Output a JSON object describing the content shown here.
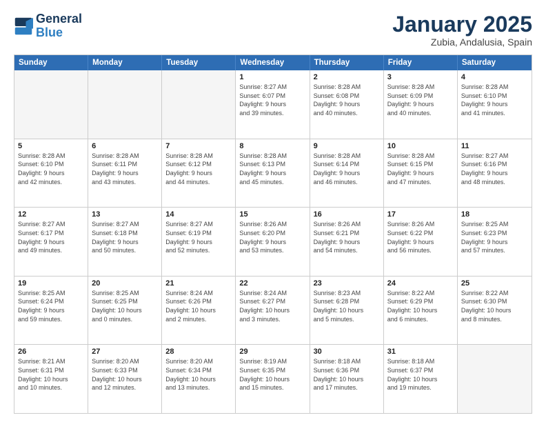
{
  "logo": {
    "line1": "General",
    "line2": "Blue"
  },
  "title": "January 2025",
  "subtitle": "Zubia, Andalusia, Spain",
  "dayHeaders": [
    "Sunday",
    "Monday",
    "Tuesday",
    "Wednesday",
    "Thursday",
    "Friday",
    "Saturday"
  ],
  "weeks": [
    [
      {
        "day": "",
        "info": ""
      },
      {
        "day": "",
        "info": ""
      },
      {
        "day": "",
        "info": ""
      },
      {
        "day": "1",
        "info": "Sunrise: 8:27 AM\nSunset: 6:07 PM\nDaylight: 9 hours\nand 39 minutes."
      },
      {
        "day": "2",
        "info": "Sunrise: 8:28 AM\nSunset: 6:08 PM\nDaylight: 9 hours\nand 40 minutes."
      },
      {
        "day": "3",
        "info": "Sunrise: 8:28 AM\nSunset: 6:09 PM\nDaylight: 9 hours\nand 40 minutes."
      },
      {
        "day": "4",
        "info": "Sunrise: 8:28 AM\nSunset: 6:10 PM\nDaylight: 9 hours\nand 41 minutes."
      }
    ],
    [
      {
        "day": "5",
        "info": "Sunrise: 8:28 AM\nSunset: 6:10 PM\nDaylight: 9 hours\nand 42 minutes."
      },
      {
        "day": "6",
        "info": "Sunrise: 8:28 AM\nSunset: 6:11 PM\nDaylight: 9 hours\nand 43 minutes."
      },
      {
        "day": "7",
        "info": "Sunrise: 8:28 AM\nSunset: 6:12 PM\nDaylight: 9 hours\nand 44 minutes."
      },
      {
        "day": "8",
        "info": "Sunrise: 8:28 AM\nSunset: 6:13 PM\nDaylight: 9 hours\nand 45 minutes."
      },
      {
        "day": "9",
        "info": "Sunrise: 8:28 AM\nSunset: 6:14 PM\nDaylight: 9 hours\nand 46 minutes."
      },
      {
        "day": "10",
        "info": "Sunrise: 8:28 AM\nSunset: 6:15 PM\nDaylight: 9 hours\nand 47 minutes."
      },
      {
        "day": "11",
        "info": "Sunrise: 8:27 AM\nSunset: 6:16 PM\nDaylight: 9 hours\nand 48 minutes."
      }
    ],
    [
      {
        "day": "12",
        "info": "Sunrise: 8:27 AM\nSunset: 6:17 PM\nDaylight: 9 hours\nand 49 minutes."
      },
      {
        "day": "13",
        "info": "Sunrise: 8:27 AM\nSunset: 6:18 PM\nDaylight: 9 hours\nand 50 minutes."
      },
      {
        "day": "14",
        "info": "Sunrise: 8:27 AM\nSunset: 6:19 PM\nDaylight: 9 hours\nand 52 minutes."
      },
      {
        "day": "15",
        "info": "Sunrise: 8:26 AM\nSunset: 6:20 PM\nDaylight: 9 hours\nand 53 minutes."
      },
      {
        "day": "16",
        "info": "Sunrise: 8:26 AM\nSunset: 6:21 PM\nDaylight: 9 hours\nand 54 minutes."
      },
      {
        "day": "17",
        "info": "Sunrise: 8:26 AM\nSunset: 6:22 PM\nDaylight: 9 hours\nand 56 minutes."
      },
      {
        "day": "18",
        "info": "Sunrise: 8:25 AM\nSunset: 6:23 PM\nDaylight: 9 hours\nand 57 minutes."
      }
    ],
    [
      {
        "day": "19",
        "info": "Sunrise: 8:25 AM\nSunset: 6:24 PM\nDaylight: 9 hours\nand 59 minutes."
      },
      {
        "day": "20",
        "info": "Sunrise: 8:25 AM\nSunset: 6:25 PM\nDaylight: 10 hours\nand 0 minutes."
      },
      {
        "day": "21",
        "info": "Sunrise: 8:24 AM\nSunset: 6:26 PM\nDaylight: 10 hours\nand 2 minutes."
      },
      {
        "day": "22",
        "info": "Sunrise: 8:24 AM\nSunset: 6:27 PM\nDaylight: 10 hours\nand 3 minutes."
      },
      {
        "day": "23",
        "info": "Sunrise: 8:23 AM\nSunset: 6:28 PM\nDaylight: 10 hours\nand 5 minutes."
      },
      {
        "day": "24",
        "info": "Sunrise: 8:22 AM\nSunset: 6:29 PM\nDaylight: 10 hours\nand 6 minutes."
      },
      {
        "day": "25",
        "info": "Sunrise: 8:22 AM\nSunset: 6:30 PM\nDaylight: 10 hours\nand 8 minutes."
      }
    ],
    [
      {
        "day": "26",
        "info": "Sunrise: 8:21 AM\nSunset: 6:31 PM\nDaylight: 10 hours\nand 10 minutes."
      },
      {
        "day": "27",
        "info": "Sunrise: 8:20 AM\nSunset: 6:33 PM\nDaylight: 10 hours\nand 12 minutes."
      },
      {
        "day": "28",
        "info": "Sunrise: 8:20 AM\nSunset: 6:34 PM\nDaylight: 10 hours\nand 13 minutes."
      },
      {
        "day": "29",
        "info": "Sunrise: 8:19 AM\nSunset: 6:35 PM\nDaylight: 10 hours\nand 15 minutes."
      },
      {
        "day": "30",
        "info": "Sunrise: 8:18 AM\nSunset: 6:36 PM\nDaylight: 10 hours\nand 17 minutes."
      },
      {
        "day": "31",
        "info": "Sunrise: 8:18 AM\nSunset: 6:37 PM\nDaylight: 10 hours\nand 19 minutes."
      },
      {
        "day": "",
        "info": ""
      }
    ]
  ]
}
